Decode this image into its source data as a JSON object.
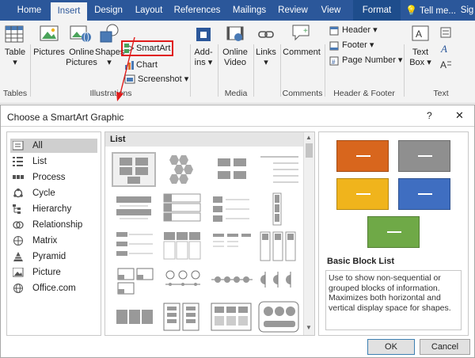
{
  "ribbon": {
    "tabs": [
      "Home",
      "Insert",
      "Design",
      "Layout",
      "References",
      "Mailings",
      "Review",
      "View",
      "Format"
    ],
    "tell_me": "Tell me...",
    "sign": "Sig",
    "buttons": {
      "table": "Table",
      "pictures": "Pictures",
      "online_pictures_1": "Online",
      "online_pictures_2": "Pictures",
      "shapes": "Shapes",
      "smartart": "SmartArt",
      "chart": "Chart",
      "screenshot": "Screenshot",
      "addins_1": "Add-",
      "addins_2": "ins",
      "online_video_1": "Online",
      "online_video_2": "Video",
      "links": "Links",
      "comment": "Comment",
      "header": "Header",
      "footer": "Footer",
      "page_number": "Page Number",
      "text_box_1": "Text",
      "text_box_2": "Box"
    },
    "groups": [
      "Tables",
      "Illustrations",
      "Media",
      "Comments",
      "Header & Footer",
      "Text"
    ]
  },
  "dialog": {
    "title": "Choose a SmartArt Graphic",
    "help": "?",
    "close": "✕",
    "categories": [
      "All",
      "List",
      "Process",
      "Cycle",
      "Hierarchy",
      "Relationship",
      "Matrix",
      "Pyramid",
      "Picture",
      "Office.com"
    ],
    "gallery_header": "List",
    "preview": {
      "title": "Basic Block List",
      "description": "Use to show non-sequential or grouped blocks of information. Maximizes both horizontal and vertical display space for shapes."
    },
    "ok": "OK",
    "cancel": "Cancel"
  },
  "colors": {
    "ribbon_blue": "#2b579a",
    "orange": "#d8661d",
    "gray": "#8f8f8f",
    "gold": "#f0b41c",
    "blue": "#3f6ec1",
    "green": "#6fa947",
    "highlight_red": "#e01b1b"
  }
}
